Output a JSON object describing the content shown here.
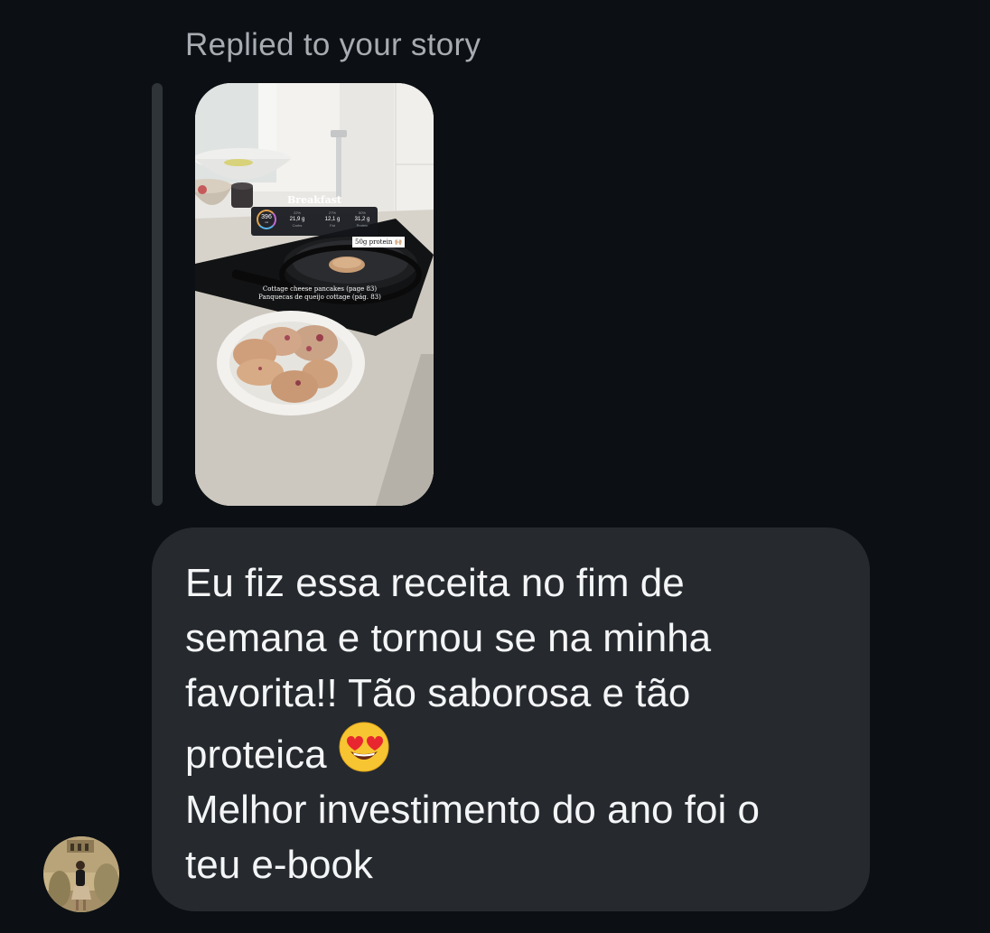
{
  "reply_header": {
    "label": "Replied to your story"
  },
  "story": {
    "title": "Breakfast",
    "calories_value": "396",
    "calories_unit": "cal",
    "macros": [
      {
        "pct": "22%",
        "amount": "21,9 g",
        "name": "Carbs"
      },
      {
        "pct": "27%",
        "amount": "12,1 g",
        "name": "Fat"
      },
      {
        "pct": "50%",
        "amount": "31,2 g",
        "name": "Protein"
      }
    ],
    "protein_tag": "50g protein 🙌🏼",
    "caption_line1": "Cottage cheese pancakes (page 83)",
    "caption_line2": "Panquecas de queijo cottage (pág. 83)"
  },
  "message": {
    "text_before_emoji": "Eu fiz essa receita no fim de\nsemana e tornou se na minha\nfavorita!! Tão saborosa e tão\nproteica ",
    "emoji": "heart-eyes-emoji",
    "text_after_emoji": "\nMelhor investimento do ano foi o\nteu e-book"
  },
  "sender": {
    "avatar": "avatar"
  },
  "colors": {
    "background": "#0c1014",
    "bubble": "#262a2f",
    "reply_bar": "#2f3439",
    "label_text": "#a8acb2",
    "message_text": "#f4f5f6"
  }
}
